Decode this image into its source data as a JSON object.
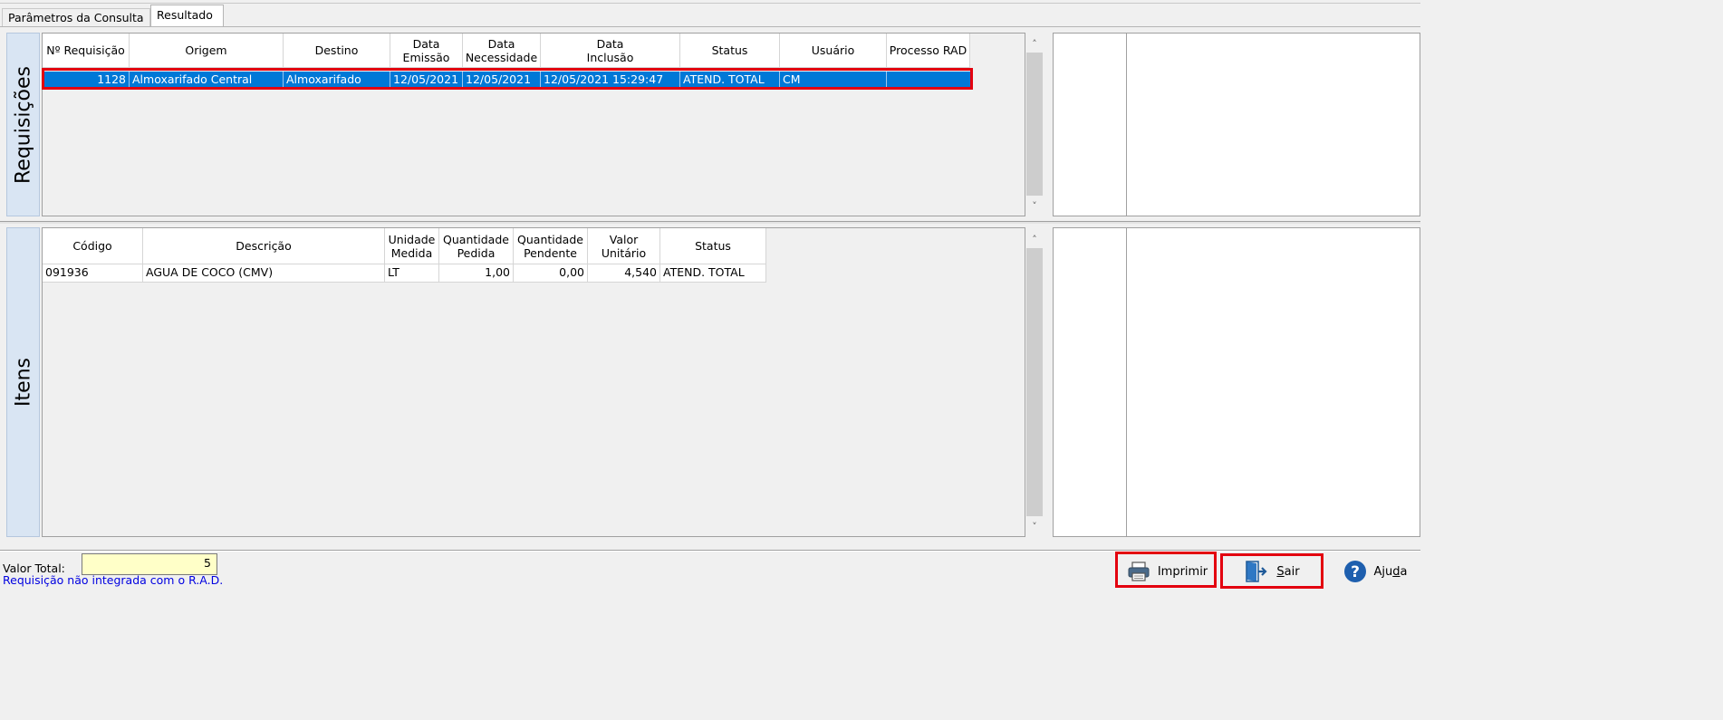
{
  "tabs": [
    {
      "label": "Parâmetros da Consulta"
    },
    {
      "label": "Resultado"
    }
  ],
  "requisicoes": {
    "side_label": "Requisições",
    "columns": [
      "Nº Requisição",
      "Origem",
      "Destino",
      "Data\nEmissão",
      "Data\nNecessidade",
      "Data\nInclusão",
      "Status",
      "Usuário",
      "Processo RAD"
    ],
    "rows": [
      {
        "numero": "1128",
        "origem": "Almoxarifado Central",
        "destino": "Almoxarifado",
        "emissao": "12/05/2021",
        "necessidade": "12/05/2021",
        "inclusao": "12/05/2021 15:29:47",
        "status": "ATEND. TOTAL",
        "usuario": "CM",
        "processo_rad": ""
      }
    ]
  },
  "itens": {
    "side_label": "Itens",
    "columns": [
      "Código",
      "Descrição",
      "Unidade\nMedida",
      "Quantidade\nPedida",
      "Quantidade\nPendente",
      "Valor\nUnitário",
      "Status"
    ],
    "rows": [
      {
        "codigo": "091936",
        "descricao": "AGUA DE COCO (CMV)",
        "unidade": "LT",
        "qtd_pedida": "1,00",
        "qtd_pendente": "0,00",
        "valor_unitario": "4,540",
        "status": "ATEND. TOTAL"
      }
    ]
  },
  "footer": {
    "valor_total_label": "Valor Total:",
    "valor_total": "5",
    "warning": "Requisição não integrada com o R.A.D."
  },
  "buttons": {
    "imprimir": "Imprimir",
    "sair_first": "S",
    "sair_rest": "air",
    "ajuda_first": "Aju",
    "ajuda_u": "d",
    "ajuda_rest": "a"
  },
  "colors": {
    "selection": "#0078d7",
    "highlight_box": "#e3000f",
    "side_label_bg": "#d9e5f3",
    "total_field_bg": "#ffffc8",
    "warning_text": "#0000e0"
  }
}
